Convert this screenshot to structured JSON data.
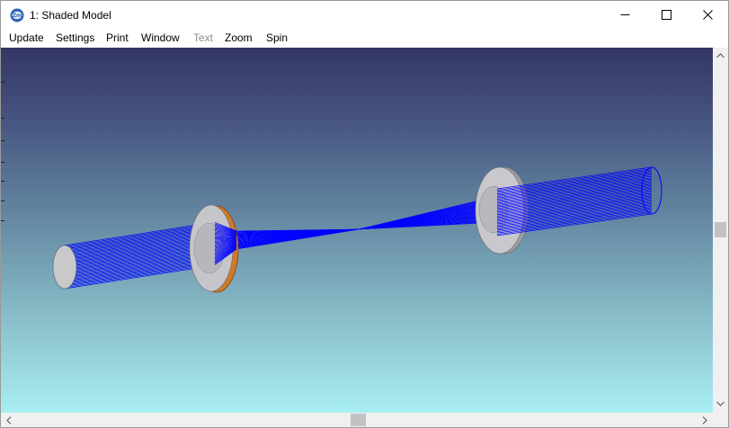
{
  "window": {
    "title": "1: Shaded Model",
    "app_icon": "zemax-logo-icon",
    "controls": [
      "minimize-icon",
      "maximize-icon",
      "close-icon"
    ]
  },
  "menu": {
    "items": [
      {
        "label": "Update",
        "enabled": true
      },
      {
        "label": "Settings",
        "enabled": true
      },
      {
        "label": "Print",
        "enabled": true
      },
      {
        "label": "Window",
        "enabled": true
      },
      {
        "label": "Text",
        "enabled": false
      },
      {
        "label": "Zoom",
        "enabled": true
      },
      {
        "label": "Spin",
        "enabled": true
      }
    ]
  },
  "viewport": {
    "content": "shaded-3d-optical-layout",
    "background_top": "#343765",
    "background_bottom": "#a8eef3",
    "ray_color": "#0000ff",
    "lens_color": "#c4c4c8",
    "lens_edge_color": "#d07a28"
  },
  "scrollbars": {
    "vertical": [
      "scroll-up-arrow-icon",
      "scroll-down-arrow-icon"
    ],
    "horizontal": [
      "scroll-left-arrow-icon",
      "scroll-right-arrow-icon"
    ]
  }
}
